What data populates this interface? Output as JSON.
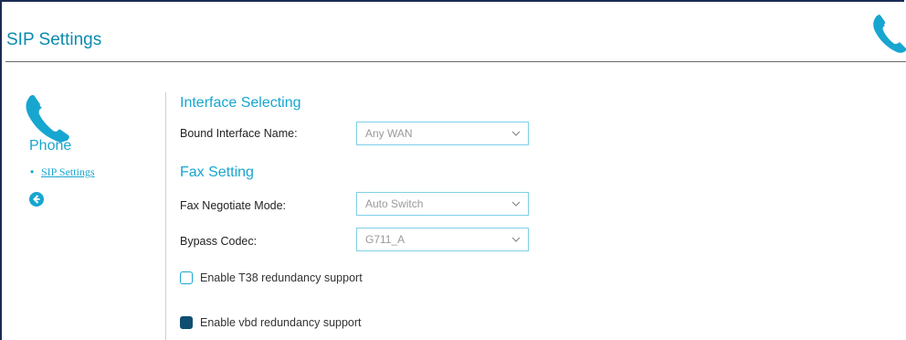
{
  "header": {
    "title": "SIP Settings",
    "icon": "phone-icon"
  },
  "sidebar": {
    "icon": "phone-icon",
    "title": "Phone",
    "bullet": "•",
    "links": [
      {
        "label": "SIP Settings"
      }
    ],
    "back_icon": "back-arrow-icon"
  },
  "main": {
    "interface": {
      "section_title": "Interface Selecting",
      "bound_label": "Bound Interface Name:",
      "bound_value": "Any WAN"
    },
    "fax": {
      "section_title": "Fax Setting",
      "negotiate_label": "Fax Negotiate Mode:",
      "negotiate_value": "Auto Switch",
      "bypass_label": "Bypass Codec:",
      "bypass_value": "G711_A"
    },
    "options": [
      {
        "label": "Enable T38 redundancy support",
        "checked": false
      },
      {
        "label": "Enable vbd redundancy support",
        "checked": true
      }
    ]
  },
  "colors": {
    "accent": "#17a6d0",
    "title": "#0b8bb0",
    "frame": "#1b2b55",
    "checked_fill": "#0f4e72"
  }
}
